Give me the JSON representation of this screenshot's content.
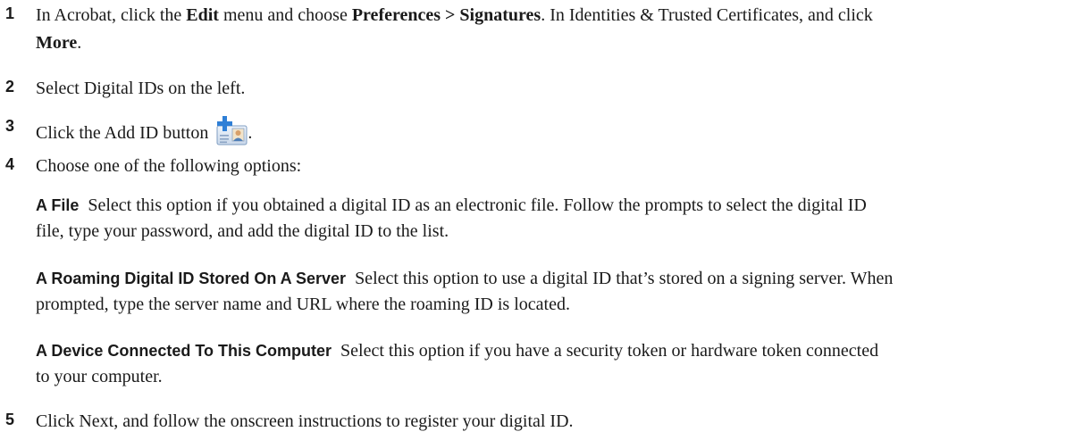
{
  "steps": {
    "s1": {
      "number": "1",
      "t1": "In Acrobat, click the ",
      "b1": "Edit",
      "t2": " menu and choose ",
      "b2": "Preferences > Signatures",
      "t3": ". In Identities & Trusted Certificates, and click",
      "b3": "More",
      "t4": "."
    },
    "s2": {
      "number": "2",
      "text": "Select Digital IDs on the left."
    },
    "s3": {
      "number": "3",
      "text": "Click the Add ID button",
      "after": ".",
      "icon": "add-id-icon"
    },
    "s4": {
      "number": "4",
      "text": "Choose one of the following options:",
      "options": [
        {
          "heading": "A File",
          "line1": "Select this option if you obtained a digital ID as an electronic file. Follow the prompts to select the digital ID",
          "line2": "file, type your password, and add the digital ID to the list."
        },
        {
          "heading": "A Roaming Digital ID Stored On A Server",
          "line1": "Select this option to use a digital ID that’s stored on a signing server. When",
          "line2": "prompted, type the server name and URL where the roaming ID is located."
        },
        {
          "heading": "A Device Connected To This Computer",
          "line1": "Select this option if you have a security token or hardware token connected",
          "line2": "to your computer."
        }
      ]
    },
    "s5": {
      "number": "5",
      "text": "Click Next, and follow the onscreen instructions to register your digital ID."
    }
  }
}
